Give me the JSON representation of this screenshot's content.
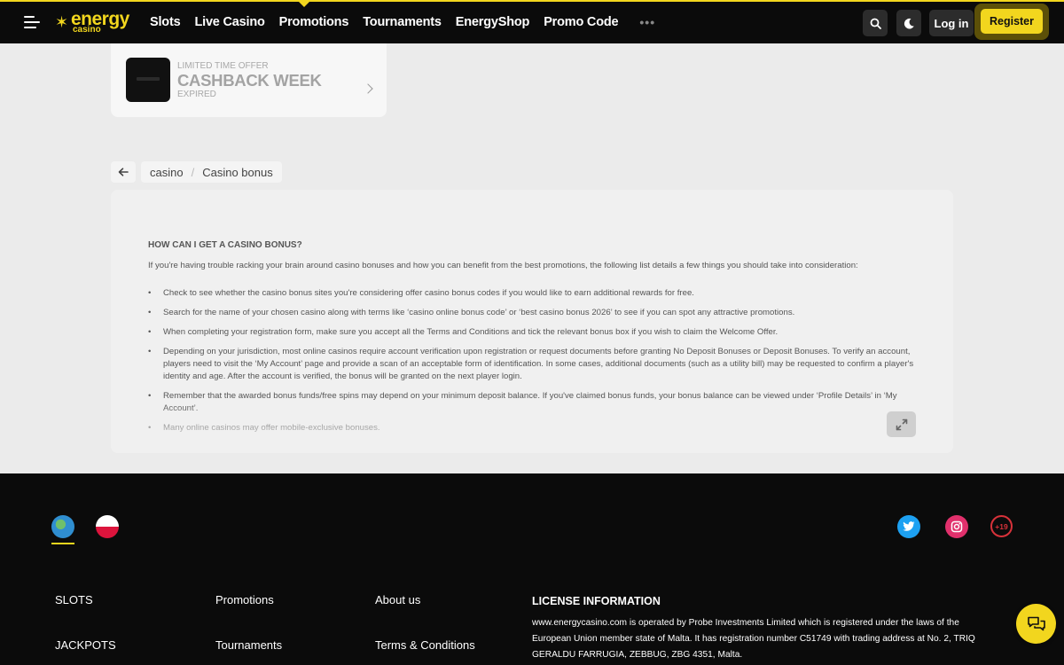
{
  "header": {
    "logo_word1": "energy",
    "logo_word2": "casino",
    "nav": [
      "Slots",
      "Live Casino",
      "Promotions",
      "Tournaments",
      "EnergyShop",
      "Promo Code"
    ],
    "more": "•••",
    "login_label": "Log in",
    "register_label": "Register",
    "accent_color": "#f2d61e"
  },
  "promo": {
    "kicker": "LIMITED TIME OFFER",
    "title": "CASHBACK WEEK",
    "status": "EXPIRED"
  },
  "breadcrumb": {
    "items": [
      "casino",
      "Casino bonus"
    ]
  },
  "article": {
    "heading": "HOW CAN I GET A CASINO BONUS?",
    "intro": "If you're having trouble racking your brain around casino bonuses and how you can benefit from the best promotions, the following list details a few things you should take into consideration:",
    "bullets": [
      "Check to see whether the casino bonus sites you're considering offer casino bonus codes if you would like to earn additional rewards for free.",
      "Search for the name of your chosen casino along with terms like ‘casino online bonus code’ or ‘best casino bonus 2026’ to see if you can spot any attractive promotions.",
      "When completing your registration form, make sure you accept all the Terms and Conditions and tick the relevant bonus box if you wish to claim the Welcome Offer.",
      "Depending on your jurisdiction, most online casinos require account verification upon registration or request documents before granting No Deposit Bonuses or Deposit Bonuses. To verify an account, players need to visit the ‘My Account’ page and provide a scan of an acceptable form of identification. In some cases, additional documents (such as a utility bill) may be requested to confirm a player's identity and age. After the account is verified, the bonus will be granted on the next player login.",
      "Remember that the awarded bonus funds/free spins may depend on your minimum deposit balance. If you've claimed bonus funds, your bonus balance can be viewed under ‘Profile Details’ in ‘My Account’.",
      "Many online casinos may offer mobile-exclusive bonuses."
    ]
  },
  "footer": {
    "age_badge": "+19",
    "col1": [
      "SLOTS",
      "JACKPOTS"
    ],
    "col2": [
      "Promotions",
      "Tournaments"
    ],
    "col3": [
      "About us",
      "Terms & Conditions"
    ],
    "license_title": "LICENSE INFORMATION",
    "license_text": "www.energycasino.com is operated by Probe Investments Limited which is registered under the laws of the European Union member state of Malta. It has registration number C51749 with trading address at No. 2, TRIQ GERALDU FARRUGIA, ZEBBUG, ZBG 4351, Malta."
  }
}
